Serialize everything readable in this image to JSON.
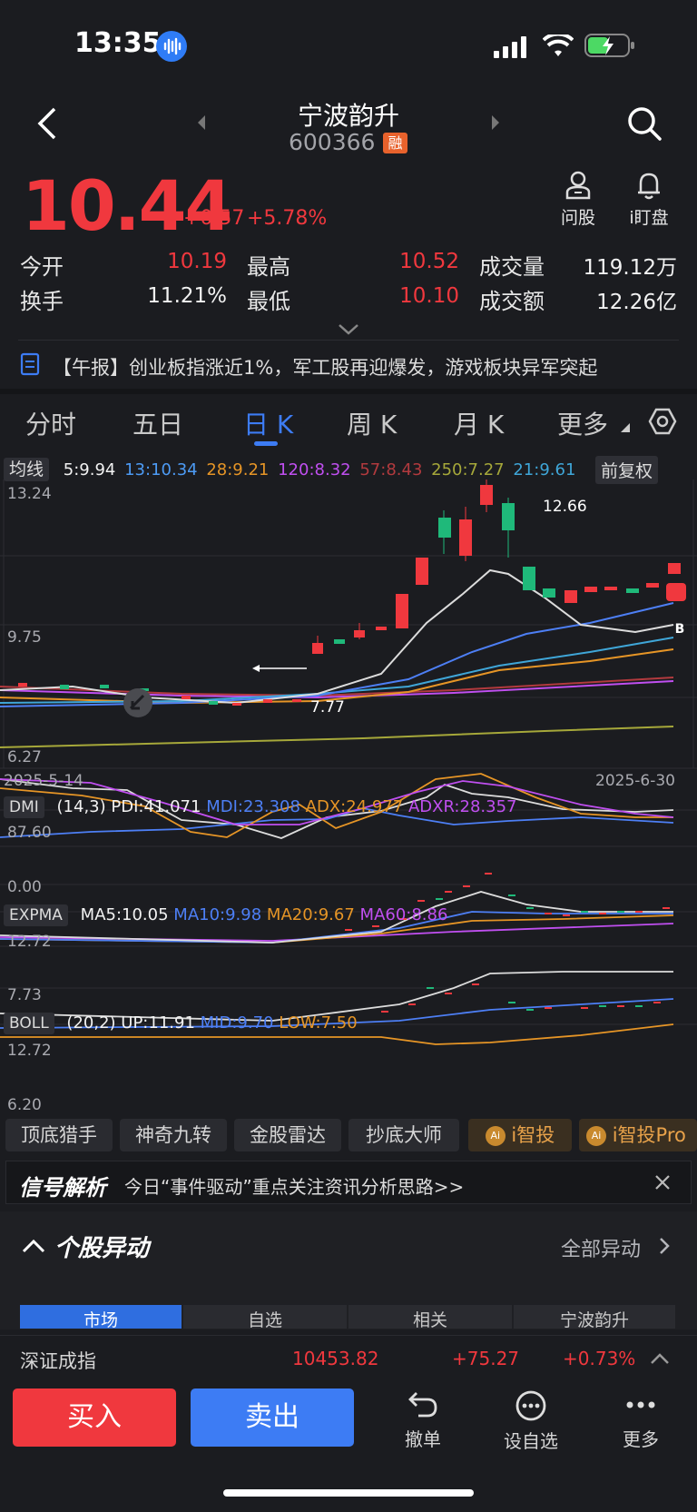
{
  "status_bar": {
    "time": "13:35"
  },
  "header": {
    "title": "宁波韵升",
    "code": "600366",
    "badge": "融"
  },
  "quote": {
    "price": "10.44",
    "change": "+0.57",
    "change_pct": "+5.78%",
    "actions": [
      {
        "label": "问股",
        "icon": "person-icon"
      },
      {
        "label": "i盯盘",
        "icon": "bell-icon"
      }
    ],
    "rows": [
      [
        {
          "label": "今开",
          "value": "10.19"
        },
        {
          "label": "最高",
          "value": "10.52"
        },
        {
          "label": "成交量",
          "value": "119.12万"
        }
      ],
      [
        {
          "label": "换手",
          "value": "11.21%"
        },
        {
          "label": "最低",
          "value": "10.10"
        },
        {
          "label": "成交额",
          "value": "12.26亿"
        }
      ]
    ]
  },
  "news": {
    "text": "【午报】创业板指涨近1%，军工股再迎爆发，游戏板块异军突起"
  },
  "tabs": [
    "分时",
    "五日",
    "日 K",
    "周 K",
    "月 K",
    "更多"
  ],
  "active_tab": "日 K",
  "ma_bar": {
    "button": "均线",
    "items": [
      "5:9.94",
      "13:10.34",
      "28:9.21",
      "120:8.32",
      "57:8.43",
      "250:7.27",
      "21:9.61"
    ],
    "adjust": "前复权"
  },
  "kline": {
    "y_top": "13.24",
    "y_mid": "9.75",
    "y_bottom": "6.27",
    "high_label": "12.66",
    "low_label": "7.77",
    "date_start": "2025-5-14",
    "date_end": "2025-6-30",
    "marker": "B"
  },
  "dmi": {
    "button": "DMI",
    "params": "(14,3)",
    "pdi": "PDI:41.071",
    "mdi": "MDI:23.308",
    "adx": "ADX:24.977",
    "adxr": "ADXR:28.357",
    "y_top": "87.60",
    "y_bottom": "0.00"
  },
  "expma": {
    "button": "EXPMA",
    "ma5": "MA5:10.05",
    "ma10": "MA10:9.98",
    "ma20": "MA20:9.67",
    "ma60": "MA60:8.86",
    "y_top": "12.72",
    "y_bottom": "7.73"
  },
  "boll": {
    "button": "BOLL",
    "params": "(20,2)",
    "up": "UP:11.91",
    "mid": "MID:9.70",
    "low": "LOW:7.50",
    "y_top": "12.72",
    "y_bottom": "6.20"
  },
  "tools": [
    "顶底猎手",
    "神奇九转",
    "金股雷达",
    "抄底大师",
    "i智投",
    "i智投Pro"
  ],
  "signal": {
    "logo": "信号解析",
    "text": "今日“事件驱动”重点关注资讯分析思路>>"
  },
  "section": {
    "title": "个股异动",
    "link": "全部异动",
    "market_tabs": [
      "市场",
      "自选",
      "相关",
      "宁波韵升"
    ]
  },
  "index_bar": {
    "name": "深证成指",
    "value": "10453.82",
    "change": "+75.27",
    "pct": "+0.73%"
  },
  "bottom_bar": {
    "buy": "买入",
    "sell": "卖出",
    "actions": [
      {
        "label": "撤单",
        "icon": "undo-icon"
      },
      {
        "label": "设自选",
        "icon": "more-circle-icon"
      },
      {
        "label": "更多",
        "icon": "more-dots-icon"
      }
    ]
  },
  "colors": {
    "up": "#f0383e",
    "down": "#1fb97a",
    "accent": "#3d7cf4",
    "background": "#1b1c20"
  }
}
